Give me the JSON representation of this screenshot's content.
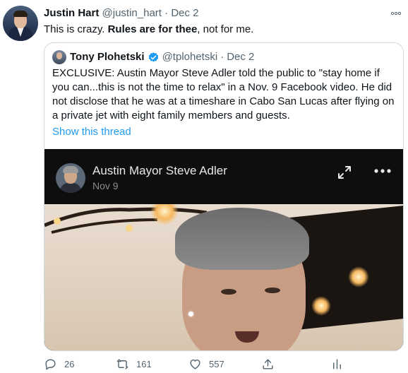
{
  "tweet": {
    "author_name": "Justin Hart",
    "author_handle": "@justin_hart",
    "separator": "·",
    "date": "Dec 2",
    "text_before": "This is crazy. ",
    "text_bold": "Rules are for thee",
    "text_after": ", not for me.",
    "more_icon": "more-dots-icon"
  },
  "quoted": {
    "author_name": "Tony Plohetski",
    "author_handle": "@tplohetski",
    "separator": "·",
    "date": "Dec 2",
    "text": "EXCLUSIVE: Austin Mayor Steve Adler told the public to \"stay home if you can...this is not the time to relax\" in a Nov. 9 Facebook video. He did not disclose that he was at a timeshare in Cabo San Lucas after flying on a private jet with eight family members and guests.",
    "show_thread": "Show this thread",
    "verified_color": "#1d9bf0"
  },
  "video": {
    "title": "Austin Mayor Steve Adler",
    "date": "Nov 9"
  },
  "actions": {
    "reply_count": "26",
    "retweet_count": "161",
    "like_count": "557"
  },
  "colors": {
    "link": "#1d9bf0",
    "muted": "#536471",
    "border": "#cfd9de"
  }
}
